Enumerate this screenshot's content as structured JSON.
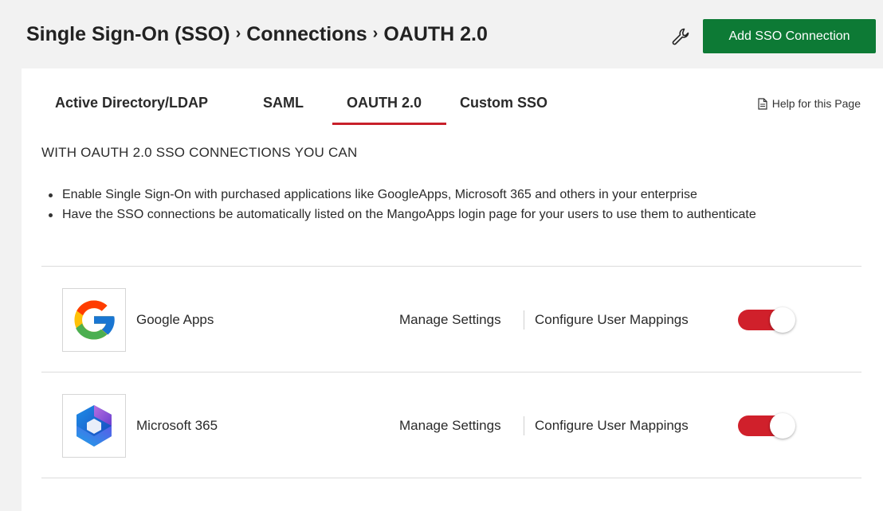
{
  "header": {
    "breadcrumb": [
      "Single Sign-On (SSO)",
      "Connections",
      "OAUTH 2.0"
    ],
    "breadcrumb_separator": "›",
    "add_button": "Add SSO Connection",
    "wrench_icon": "wrench-icon",
    "add_button_color": "#0d7a35"
  },
  "tabs": [
    {
      "label": "Active Directory/LDAP",
      "active": false
    },
    {
      "label": "SAML",
      "active": false
    },
    {
      "label": "OAUTH 2.0",
      "active": true
    },
    {
      "label": "Custom SSO",
      "active": false
    }
  ],
  "active_tab_color": "#c8202a",
  "help": {
    "label": "Help for this Page",
    "icon": "document-icon"
  },
  "intro": {
    "title": "WITH OAUTH 2.0 SSO CONNECTIONS YOU CAN",
    "bullets": [
      "Enable Single Sign-On with purchased applications like GoogleApps, Microsoft 365 and others in your enterprise",
      "Have the SSO connections be automatically listed on the MangoApps login page for your users to use them to authenticate"
    ]
  },
  "connections": [
    {
      "name": "Google Apps",
      "logo": "google-logo-icon",
      "manage": "Manage Settings",
      "configure": "Configure User Mappings",
      "enabled": true
    },
    {
      "name": "Microsoft 365",
      "logo": "microsoft-365-logo-icon",
      "manage": "Manage Settings",
      "configure": "Configure User Mappings",
      "enabled": true
    }
  ],
  "toggle_color": "#d0202b"
}
